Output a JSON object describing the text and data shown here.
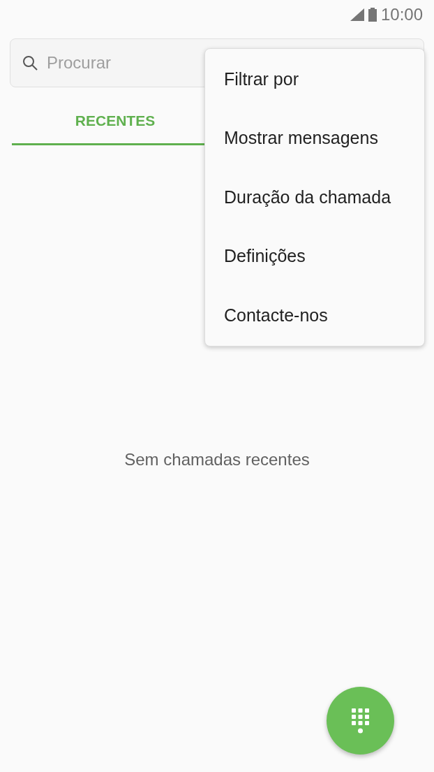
{
  "status_bar": {
    "time": "10:00"
  },
  "search": {
    "placeholder": "Procurar"
  },
  "tabs": [
    {
      "label": "RECENTES",
      "selected": true
    }
  ],
  "empty_message": "Sem chamadas recentes",
  "menu": {
    "items": [
      {
        "label": "Filtrar por"
      },
      {
        "label": "Mostrar mensagens"
      },
      {
        "label": "Duração da chamada"
      },
      {
        "label": "Definições"
      },
      {
        "label": "Contacte-nos"
      }
    ]
  }
}
